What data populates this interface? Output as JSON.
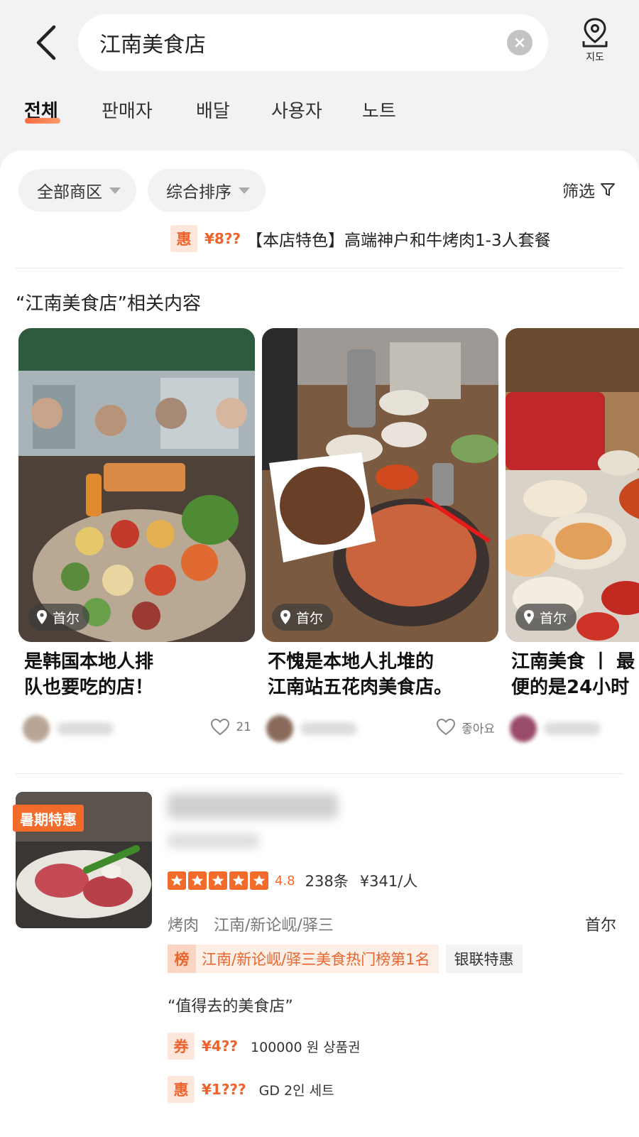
{
  "header": {
    "search_value": "江南美食店",
    "map_label": "지도"
  },
  "tabs": [
    {
      "label": "전체",
      "active": true
    },
    {
      "label": "판매자"
    },
    {
      "label": "배달"
    },
    {
      "label": "사용자"
    },
    {
      "label": "노트"
    }
  ],
  "filters": {
    "area": "全部商区",
    "sort": "综合排序",
    "filter": "筛选"
  },
  "top_promo": {
    "badge": "惠",
    "price": "¥8??",
    "text": "【本店特色】高端神户和牛烤肉1-3人套餐"
  },
  "related": {
    "title": "“江南美食店”相关内容",
    "cards": [
      {
        "location": "首尔",
        "title_line1": "是韩国本地人排",
        "title_line2": "队也要吃的店！",
        "likes": "21"
      },
      {
        "location": "首尔",
        "title_line1": "不愧是本地人扎堆的",
        "title_line2": "江南站五花肉美食店。",
        "likes": "좋아요"
      },
      {
        "location": "首尔",
        "title_line1": "江南美食 丨 最",
        "title_line2": "便的是24小时",
        "likes": ""
      }
    ]
  },
  "shop": {
    "summer_badge": "暑期特惠",
    "score": "4.8",
    "reviews": "238条",
    "per_person": "¥341/人",
    "category": "烤肉",
    "area": "江南/新论岘/驿三",
    "city": "首尔",
    "rank_badge": "榜",
    "rank_text": "江南/新论岘/驿三美食热门榜第1名",
    "union_tag": "银联特惠",
    "quote": "“值得去的美食店”",
    "deals": [
      {
        "badge": "券",
        "price": "¥4??",
        "text": "100000 원 상품권"
      },
      {
        "badge": "惠",
        "price": "¥1???",
        "text": "GD 2인 세트"
      }
    ]
  },
  "colors": {
    "accent": "#f26b2a",
    "background": "#f2f2f4"
  }
}
